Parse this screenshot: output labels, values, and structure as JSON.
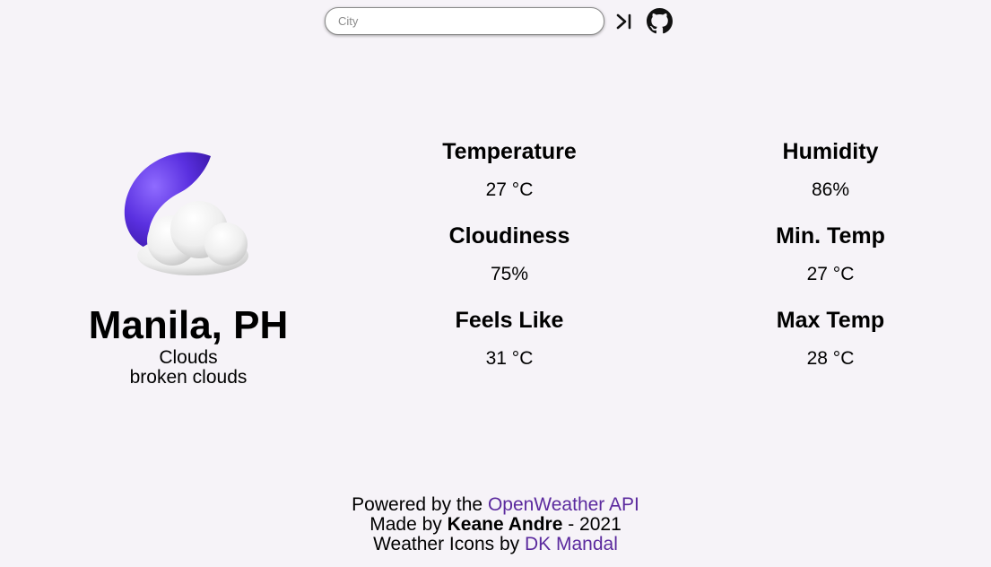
{
  "search": {
    "placeholder": "City",
    "value": ""
  },
  "header": {
    "submit_icon": "arrow-to-end-icon",
    "github_icon": "github-icon"
  },
  "weather": {
    "icon": "moon-cloud-icon",
    "city": "Manila, PH",
    "main": "Clouds",
    "description": "broken clouds"
  },
  "stats": {
    "temperature": {
      "label": "Temperature",
      "value": "27 °C"
    },
    "humidity": {
      "label": "Humidity",
      "value": "86%"
    },
    "cloudiness": {
      "label": "Cloudiness",
      "value": "75%"
    },
    "min_temp": {
      "label": "Min. Temp",
      "value": "27 °C"
    },
    "feels_like": {
      "label": "Feels Like",
      "value": "31 °C"
    },
    "max_temp": {
      "label": "Max Temp",
      "value": "28 °C"
    }
  },
  "footer": {
    "line1_prefix": "Powered by the ",
    "line1_link": "OpenWeather API",
    "line2_prefix": "Made by ",
    "line2_author": "Keane Andre",
    "line2_suffix": " - 2021",
    "line3_prefix": "Weather Icons by ",
    "line3_link": "DK Mandal"
  },
  "colors": {
    "background": "#f6f3f8",
    "link": "#5b2a9e",
    "moon": "#6a3df0"
  }
}
